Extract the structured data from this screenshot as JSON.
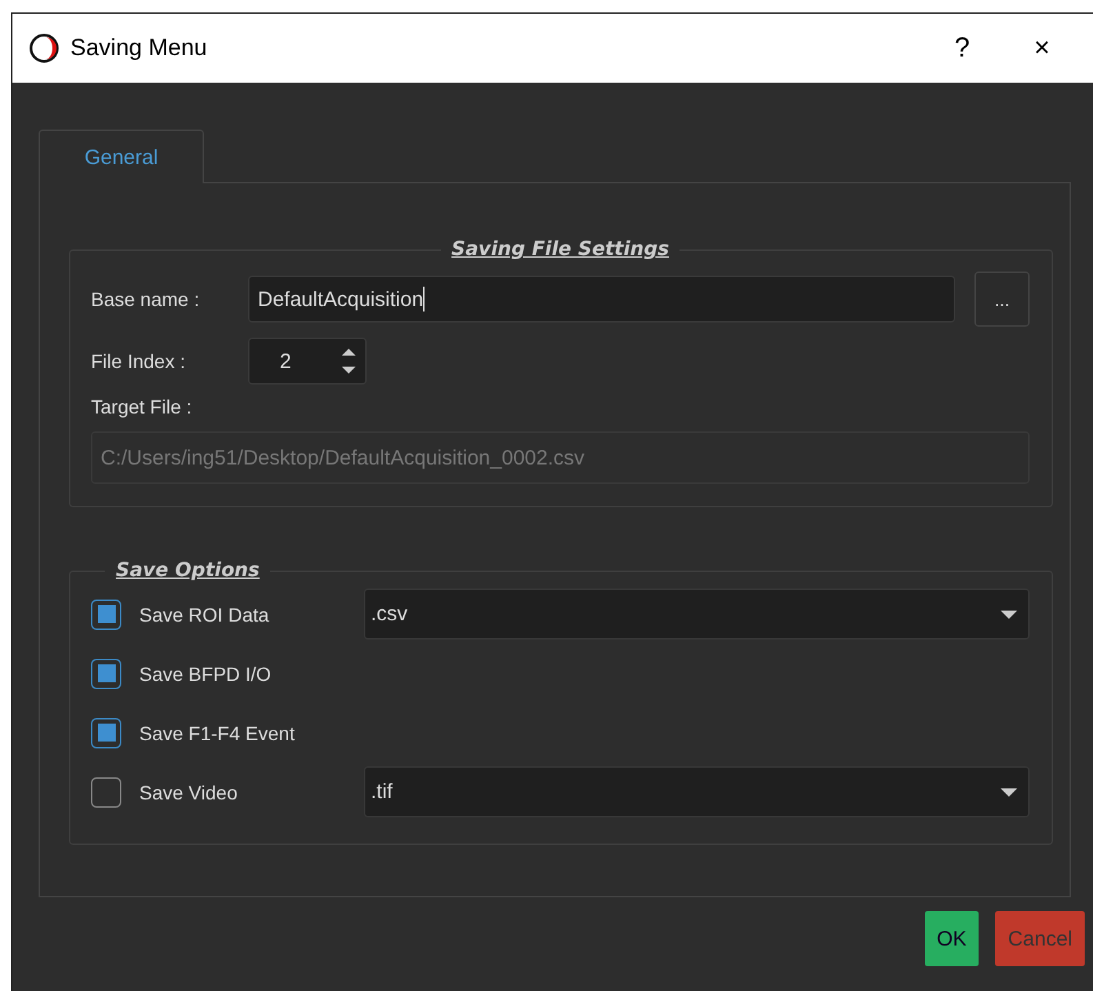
{
  "window": {
    "title": "Saving Menu",
    "help": "?",
    "close": "×"
  },
  "tabs": [
    {
      "label": "General",
      "selected": true
    }
  ],
  "file_settings": {
    "title": "Saving File Settings",
    "base_name": {
      "label": "Base name :",
      "value": "DefaultAcquisition",
      "browse": "..."
    },
    "file_index": {
      "label": "File Index :",
      "value": "2"
    },
    "target_file": {
      "label": "Target File :",
      "value": "C:/Users/ing51/Desktop/DefaultAcquisition_0002.csv",
      "disabled": true
    }
  },
  "save_options": {
    "title": "Save Options",
    "options": [
      {
        "label": "Save ROI Data",
        "checked": true,
        "dropdown": ".csv"
      },
      {
        "label": "Save BFPD I/O",
        "checked": true
      },
      {
        "label": "Save F1-F4 Event",
        "checked": true
      },
      {
        "label": "Save Video",
        "checked": false,
        "dropdown": ".tif"
      }
    ]
  },
  "buttons": [
    {
      "label": "OK",
      "kind": "ok"
    },
    {
      "label": "Cancel",
      "kind": "cancel"
    }
  ]
}
